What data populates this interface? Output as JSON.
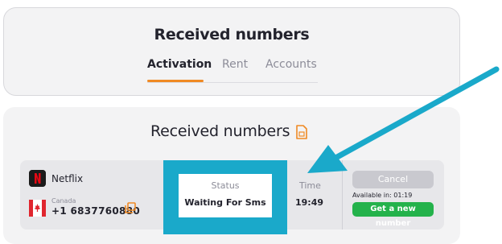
{
  "header": {
    "title": "Received numbers",
    "tabs": [
      {
        "label": "Activation",
        "active": true
      },
      {
        "label": "Rent",
        "active": false
      },
      {
        "label": "Accounts",
        "active": false
      }
    ],
    "accent_color": "#f08a24"
  },
  "numbers_list": {
    "title": "Received numbers",
    "title_icon": "document-icon",
    "rows": [
      {
        "service": "Netflix",
        "service_icon": "netflix-logo",
        "country": "Canada",
        "country_flag": "canada-flag-icon",
        "phone": "+1 6837760880",
        "status_label": "Status",
        "status": "Waiting For Sms",
        "time_label": "Time",
        "time": "19:49",
        "cancel_label": "Cancel",
        "available_text": "Available in: 01:19",
        "new_number_label": "Get a new number"
      }
    ]
  },
  "annotation": {
    "color": "#1aa9ca"
  }
}
